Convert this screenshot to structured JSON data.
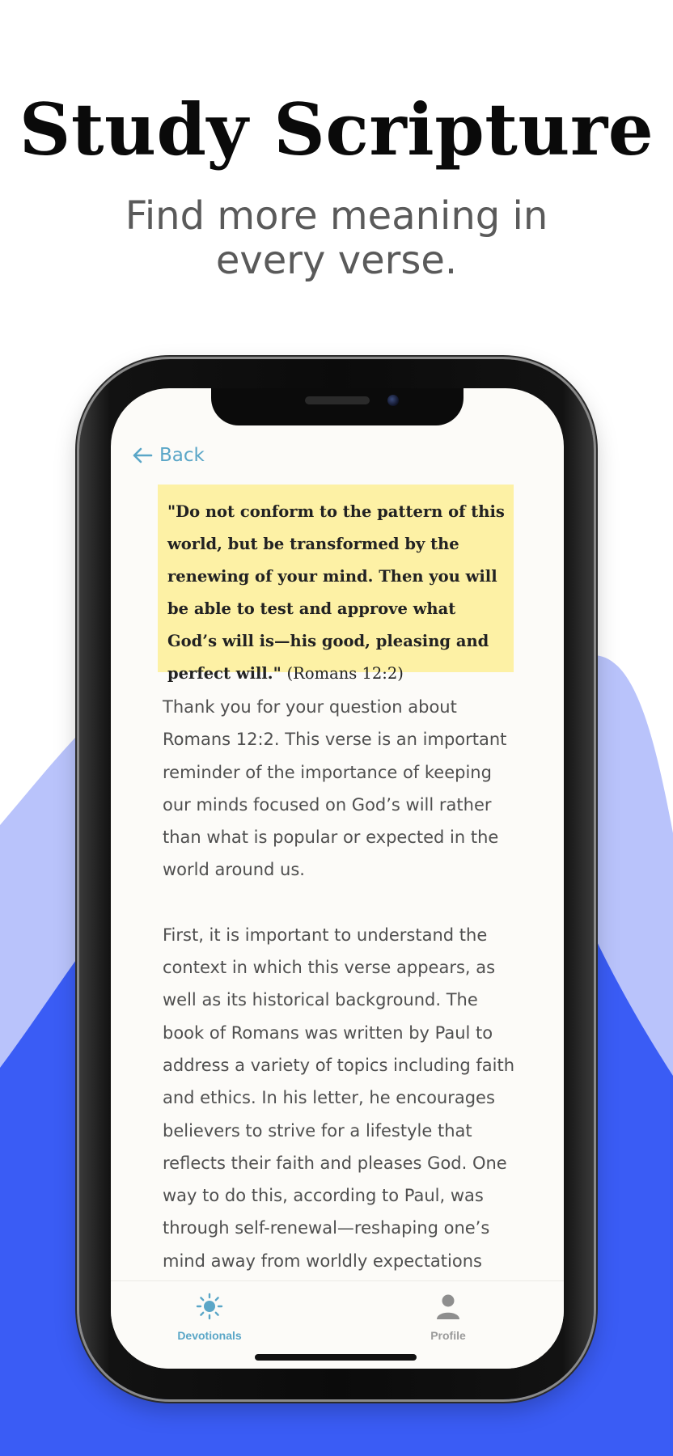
{
  "headline": "Study Scripture",
  "subhead": "Find more meaning in every verse.",
  "colors": {
    "accent_blue": "#3a5cf5",
    "light_blue": "#b9c3fb",
    "highlight_yellow": "#fdf1a5",
    "link": "#5aa6c7"
  },
  "app": {
    "back_label": "Back",
    "verse": {
      "quote": "\"Do not conform to the pattern of this world, but be transformed by the renewing of your mind. Then you will be able to test and approve what God’s will is—his good, pleasing and perfect will.\"",
      "reference": "(Romans 12:2)"
    },
    "paragraphs": [
      "Thank you for your question about Romans 12:2. This verse is an important reminder of the importance of keeping our minds focused on God’s will rather than what is popular or expected in the world around us.",
      "First, it is important to understand the context in which this verse appears, as well as its historical background. The book of Romans was written by Paul to address a variety of topics including faith and ethics. In his letter, he encourages believers to strive for a lifestyle that reflects their faith and pleases God. One way to do this, according to Paul, was through self-renewal—reshaping one’s mind away from worldly expectations"
    ],
    "tabs": [
      {
        "label": "Devotionals",
        "icon": "sun-icon",
        "active": true
      },
      {
        "label": "Profile",
        "icon": "person-icon",
        "active": false
      }
    ]
  }
}
